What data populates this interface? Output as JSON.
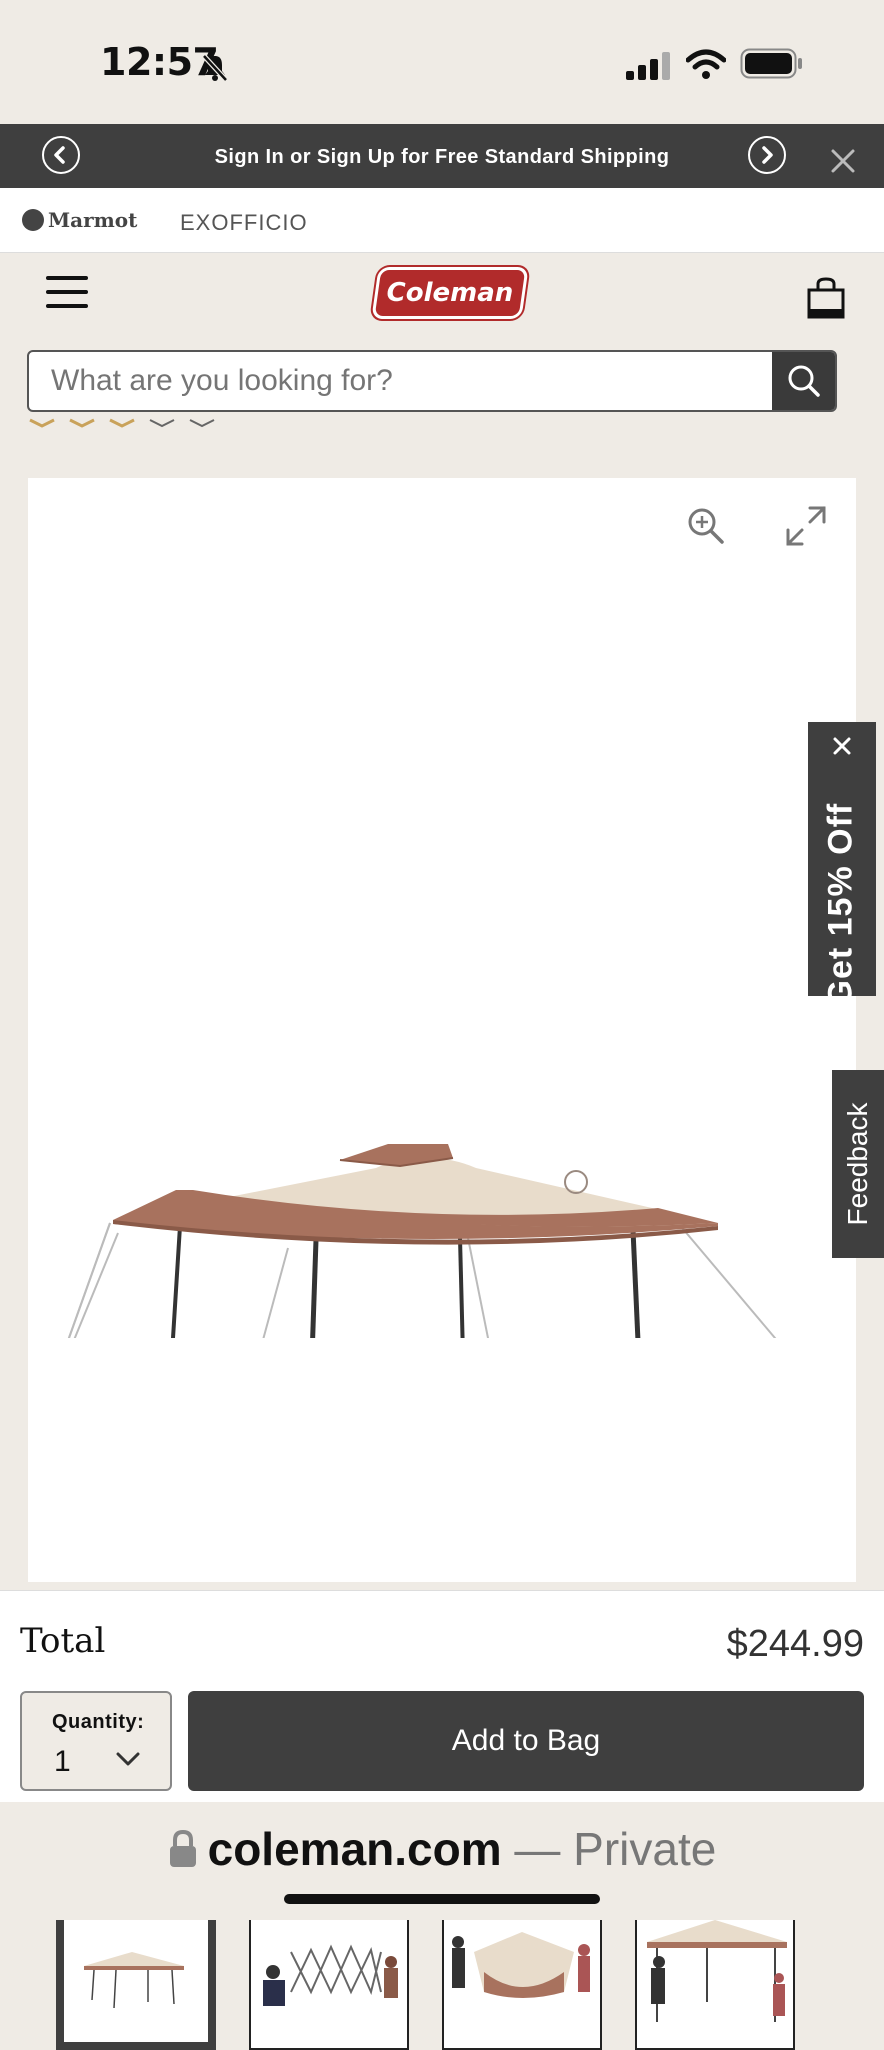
{
  "status_bar": {
    "time": "12:57"
  },
  "promo_banner": {
    "text": "Sign In or Sign Up for Free Standard Shipping"
  },
  "brands": {
    "marmot": "Marmot",
    "exofficio": "EXOFFICIO"
  },
  "header": {
    "logo_text": "Coleman"
  },
  "search": {
    "placeholder": "What are you looking for?"
  },
  "side_tabs": {
    "discount": "Get 15% Off",
    "feedback": "Feedback"
  },
  "product": {
    "thumbnails": [
      "thumbnail-1",
      "thumbnail-2",
      "thumbnail-3",
      "thumbnail-4"
    ],
    "selected_thumbnail": 0
  },
  "purchase": {
    "total_label": "Total",
    "total_price": "$244.99",
    "quantity_label": "Quantity:",
    "quantity_value": "1",
    "add_button": "Add to Bag"
  },
  "browser": {
    "domain": "coleman.com",
    "privacy": "— Private"
  },
  "colors": {
    "banner": "#3f3f3f",
    "logo_red": "#b12b2b",
    "page_bg": "#efebe5",
    "canopy_tan": "#e8dccb",
    "canopy_brown": "#a8725e"
  }
}
